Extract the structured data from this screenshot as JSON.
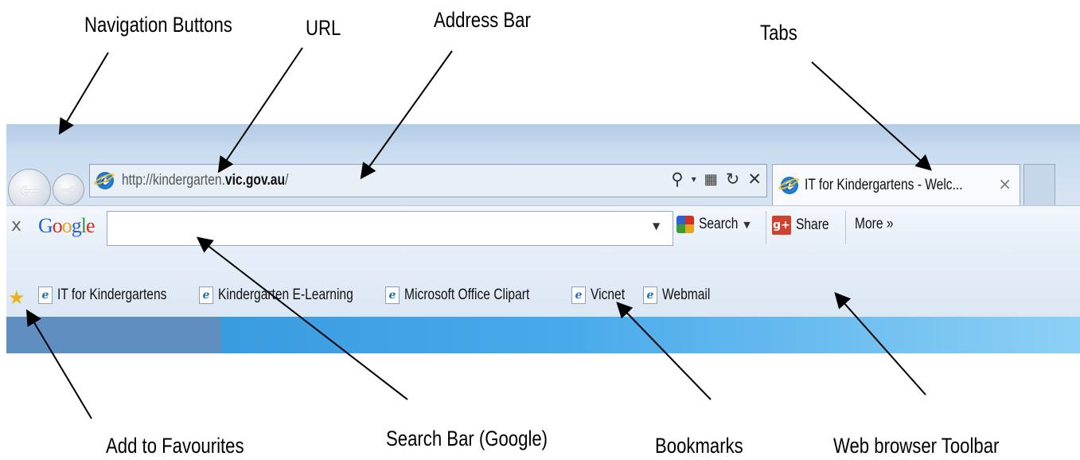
{
  "annotations": {
    "navigation_buttons": "Navigation Buttons",
    "url": "URL",
    "address_bar": "Address Bar",
    "tabs": "Tabs",
    "add_to_favourites": "Add to Favourites",
    "search_bar": "Search Bar (Google)",
    "bookmarks": "Bookmarks",
    "web_browser_toolbar": "Web browser Toolbar"
  },
  "browser": {
    "url_prefix": "http://kindergarten.",
    "url_bold": "vic.gov.au",
    "url_suffix": "/",
    "tab_title": "IT for Kindergartens - Welc...",
    "tab_close": "×"
  },
  "google_toolbar": {
    "close": "x",
    "logo": "Google",
    "search_value": "",
    "search_label": "Search",
    "share_label": "Share",
    "more_label": "More »"
  },
  "favorites": [
    "IT for Kindergartens",
    "Kindergarten E-Learning",
    "Microsoft Office Clipart",
    "Vicnet",
    "Webmail"
  ]
}
